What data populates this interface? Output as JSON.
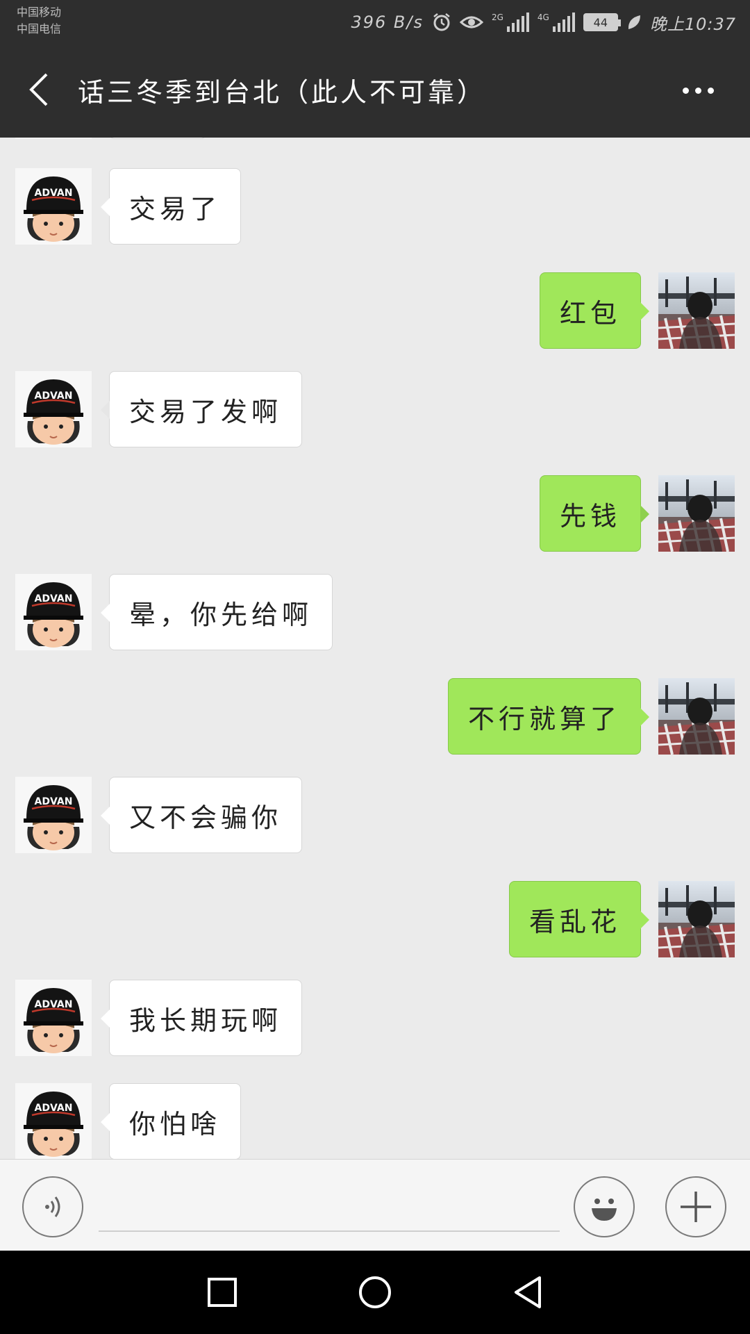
{
  "status_bar": {
    "carrier_1": "中国移动",
    "carrier_2": "中国电信",
    "net_speed": "396 B/s",
    "signal_1_type": "2G",
    "signal_2_type": "4G",
    "battery": "44",
    "time": "晚上10:37",
    "icons": [
      "alarm-icon",
      "eye-icon",
      "signal-icon",
      "battery-icon",
      "leaf-icon"
    ]
  },
  "header": {
    "title": "话三冬季到台北（此人不可靠）",
    "icons": [
      "back-arrow-icon",
      "more-dots-icon"
    ]
  },
  "messages": [
    {
      "side": "in",
      "text": "交易了"
    },
    {
      "side": "out",
      "text": "红包"
    },
    {
      "side": "in",
      "text": "交易了发啊"
    },
    {
      "side": "out",
      "text": "先钱"
    },
    {
      "side": "in",
      "text": "晕，你先给啊"
    },
    {
      "side": "out",
      "text": "不行就算了"
    },
    {
      "side": "in",
      "text": "又不会骗你"
    },
    {
      "side": "out",
      "text": "看乱花"
    },
    {
      "side": "in",
      "text": "我长期玩啊"
    },
    {
      "side": "in",
      "text": "你怕啥"
    }
  ],
  "contact_avatar_text": "ADVAN",
  "input_bar": {
    "placeholder": "",
    "icons": [
      "voice-icon",
      "emoji-icon",
      "plus-icon"
    ]
  },
  "nav_bar": {
    "icons": [
      "recent-apps-icon",
      "home-icon",
      "back-icon"
    ]
  },
  "colors": {
    "header_bg": "#2e2e2e",
    "chat_bg": "#ebebeb",
    "outgoing_bubble": "#a0e75a",
    "incoming_bubble": "#ffffff"
  }
}
